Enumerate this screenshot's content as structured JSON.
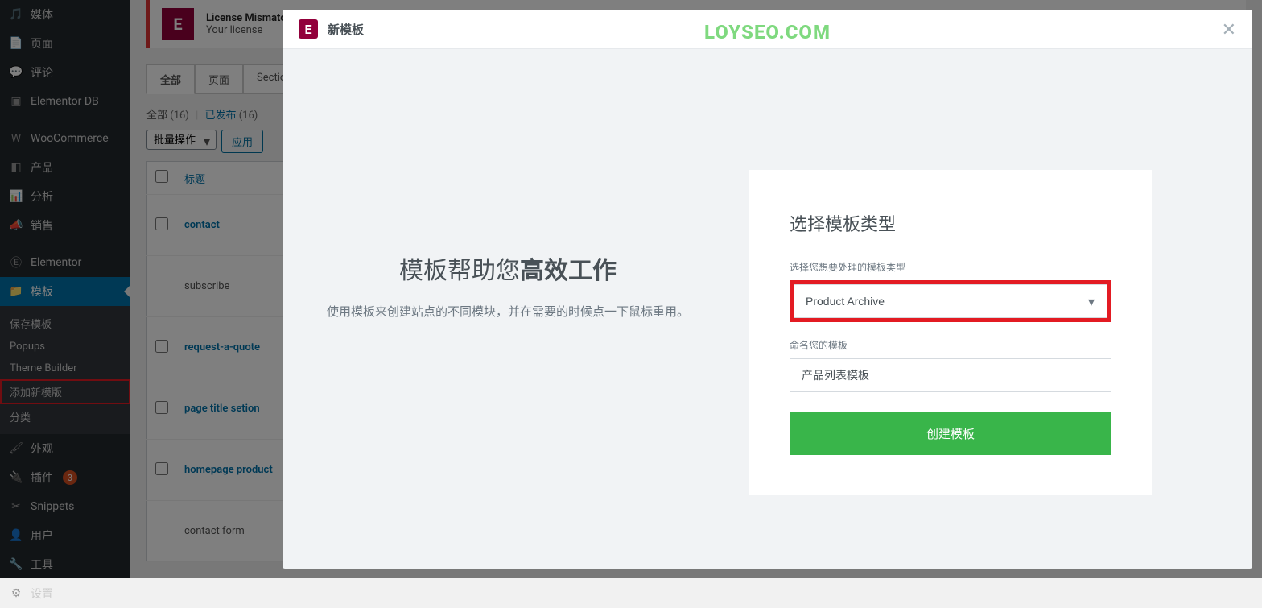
{
  "sidebar": {
    "items": [
      {
        "label": "媒体",
        "icon": "media"
      },
      {
        "label": "页面",
        "icon": "page"
      },
      {
        "label": "评论",
        "icon": "comment"
      },
      {
        "label": "Elementor DB",
        "icon": "db"
      },
      {
        "label": "WooCommerce",
        "icon": "woo"
      },
      {
        "label": "产品",
        "icon": "product"
      },
      {
        "label": "分析",
        "icon": "analytics"
      },
      {
        "label": "销售",
        "icon": "sales"
      },
      {
        "label": "Elementor",
        "icon": "elementor"
      },
      {
        "label": "模板",
        "icon": "templates"
      },
      {
        "label": "外观",
        "icon": "appearance"
      },
      {
        "label": "插件",
        "icon": "plugins",
        "badge": "3"
      },
      {
        "label": "Snippets",
        "icon": "snippets"
      },
      {
        "label": "用户",
        "icon": "users"
      },
      {
        "label": "工具",
        "icon": "tools"
      },
      {
        "label": "设置",
        "icon": "settings"
      }
    ],
    "submenu": [
      {
        "label": "保存模板"
      },
      {
        "label": "Popups"
      },
      {
        "label": "Theme Builder"
      },
      {
        "label": "添加新模版",
        "highlighted": true
      },
      {
        "label": "分类"
      }
    ]
  },
  "notice": {
    "title": "License Mismatch",
    "text": "Your license"
  },
  "tabs": [
    "全部",
    "页面",
    "Section"
  ],
  "filter": {
    "all_label": "全部",
    "all_count": "(16)",
    "sep": "|",
    "published_label": "已发布",
    "published_count": "(16)"
  },
  "bulk": {
    "select_label": "批量操作",
    "apply_label": "应用"
  },
  "table": {
    "header_title": "标题",
    "rows": [
      {
        "title": "contact"
      },
      {
        "title": "subscribe"
      },
      {
        "title": "request-a-quote"
      },
      {
        "title": "page title setion"
      },
      {
        "title": "homepage product"
      },
      {
        "title": "contact form"
      }
    ]
  },
  "watermark": "LOYSEO.COM",
  "modal": {
    "title": "新模板",
    "heading_prefix": "模板帮助您",
    "heading_bold": "高效工作",
    "description": "使用模板来创建站点的不同模块，并在需要的时候点一下鼠标重用。",
    "form": {
      "heading": "选择模板类型",
      "type_label": "选择您想要处理的模板类型",
      "type_value": "Product Archive",
      "name_label": "命名您的模板",
      "name_value": "产品列表模板",
      "submit_label": "创建模板"
    },
    "close_symbol": "✕"
  }
}
